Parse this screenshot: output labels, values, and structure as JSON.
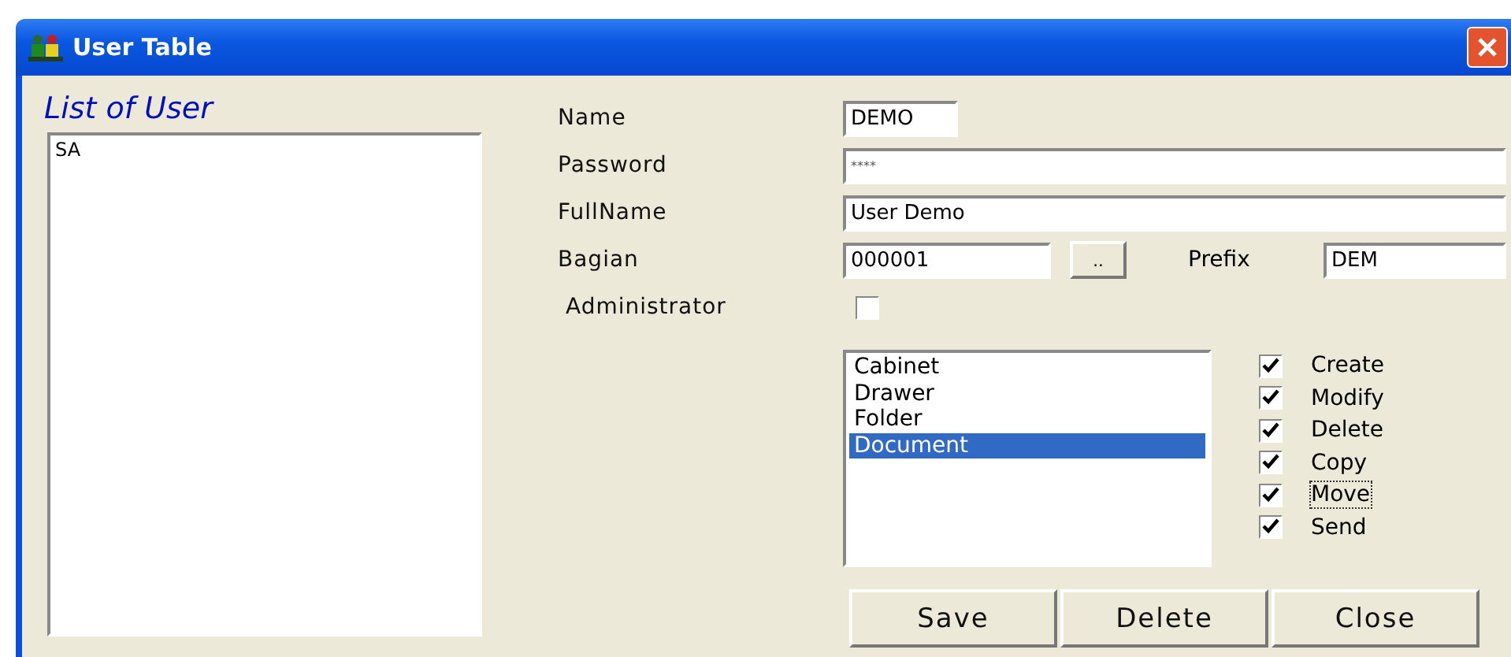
{
  "window": {
    "title": "User Table"
  },
  "user_list": {
    "title": "List of User",
    "items": [
      {
        "label": "SA",
        "selected": false
      }
    ]
  },
  "form": {
    "name": {
      "label": "Name",
      "value": "DEMO"
    },
    "password": {
      "label": "Password",
      "value": "****"
    },
    "fullname": {
      "label": "FullName",
      "value": "User Demo"
    },
    "bagian": {
      "label": "Bagian",
      "value": "000001",
      "browse_button": ".."
    },
    "prefix": {
      "label": "Prefix",
      "value": "DEM"
    },
    "administrator": {
      "label": "Administrator",
      "checked": false
    }
  },
  "levels": [
    {
      "label": "Cabinet",
      "selected": false
    },
    {
      "label": "Drawer",
      "selected": false
    },
    {
      "label": "Folder",
      "selected": false
    },
    {
      "label": "Document",
      "selected": true
    }
  ],
  "permissions": [
    {
      "label": "Create",
      "checked": true,
      "focused": false
    },
    {
      "label": "Modify",
      "checked": true,
      "focused": false
    },
    {
      "label": "Delete",
      "checked": true,
      "focused": false
    },
    {
      "label": "Copy",
      "checked": true,
      "focused": false
    },
    {
      "label": "Move",
      "checked": true,
      "focused": true
    },
    {
      "label": "Send",
      "checked": true,
      "focused": false
    }
  ],
  "buttons": [
    "Save",
    "Delete",
    "Close"
  ]
}
